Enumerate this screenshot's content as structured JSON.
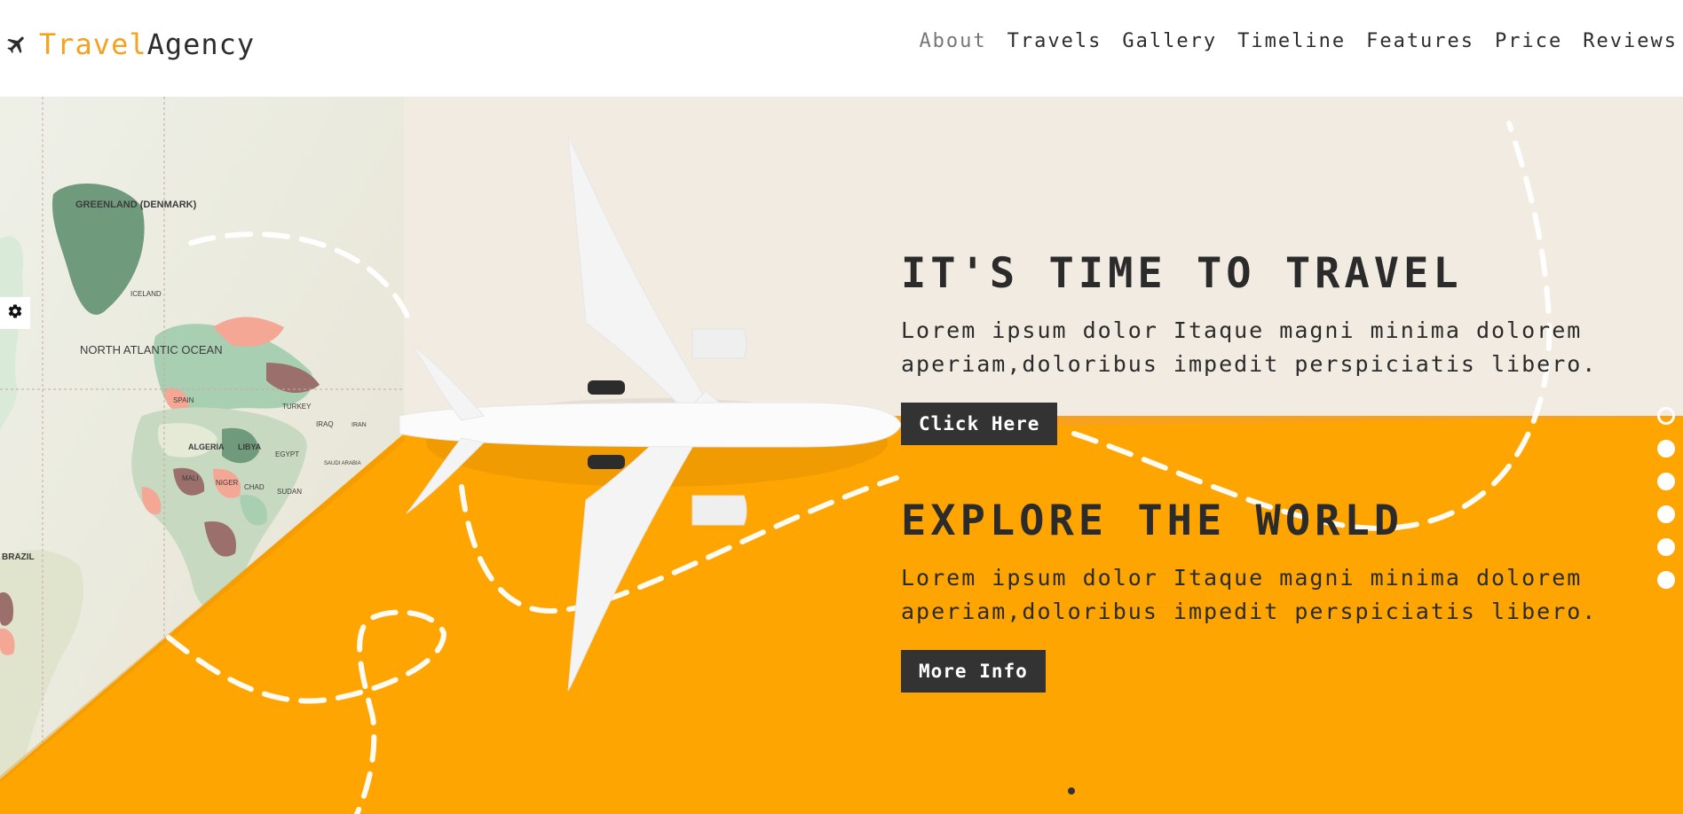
{
  "brand": {
    "icon": "airplane-icon",
    "accent_text": "Travel",
    "rest_text": "Agency",
    "accent_color": "#f6a21e"
  },
  "nav": {
    "items": [
      {
        "label": "About",
        "active": true
      },
      {
        "label": "Travels",
        "active": false
      },
      {
        "label": "Gallery",
        "active": false
      },
      {
        "label": "Timeline",
        "active": false
      },
      {
        "label": "Features",
        "active": false
      },
      {
        "label": "Price",
        "active": false
      },
      {
        "label": "Reviews",
        "active": false
      }
    ]
  },
  "settings": {
    "icon": "gear-icon"
  },
  "hero": {
    "background_color": "#f2ebe1",
    "accent_color": "#ffa502",
    "slides": [
      {
        "title": "IT'S TIME TO TRAVEL",
        "text": "Lorem ipsum dolor Itaque magni minima dolorem aperiam,doloribus impedit perspiciatis libero.",
        "button": "Click Here"
      },
      {
        "title": "EXPLORE THE WORLD",
        "text": "Lorem ipsum dolor Itaque magni minima dolorem aperiam,doloribus impedit perspiciatis libero.",
        "button": "More Info"
      }
    ],
    "map_labels": [
      "GREENLAND (DENMARK)",
      "ICELAND",
      "NORTH ATLANTIC OCEAN",
      "SPAIN",
      "ALGERIA",
      "LIBYA",
      "EGYPT",
      "TURKEY",
      "IRAQ",
      "IRAN",
      "SAUDI ARABIA",
      "MALI",
      "NIGER",
      "CHAD",
      "SUDAN",
      "BRAZIL"
    ],
    "pager": {
      "count": 6,
      "active_index": 0
    }
  }
}
